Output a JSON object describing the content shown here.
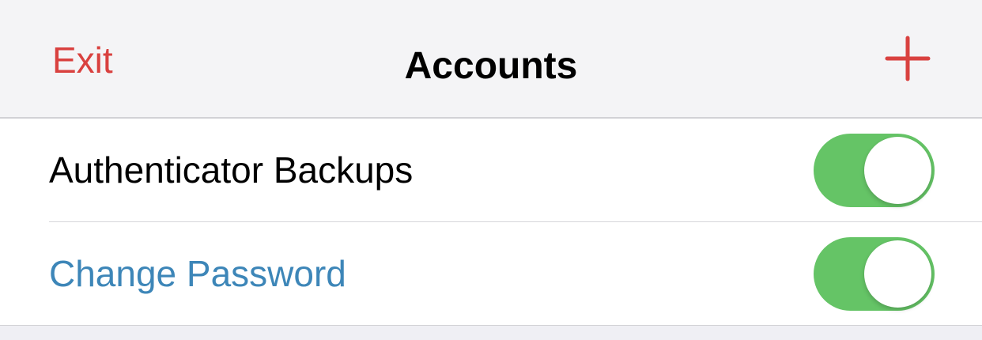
{
  "nav": {
    "exit_label": "Exit",
    "title": "Accounts",
    "add_icon": "plus-icon",
    "accent_color": "#d9413f"
  },
  "settings": {
    "rows": [
      {
        "label": "Authenticator Backups",
        "toggle_on": true
      },
      {
        "label": "Change Password",
        "toggle_on": true
      }
    ],
    "toggle_on_color": "#65c466",
    "link_color": "#3d86b8"
  }
}
